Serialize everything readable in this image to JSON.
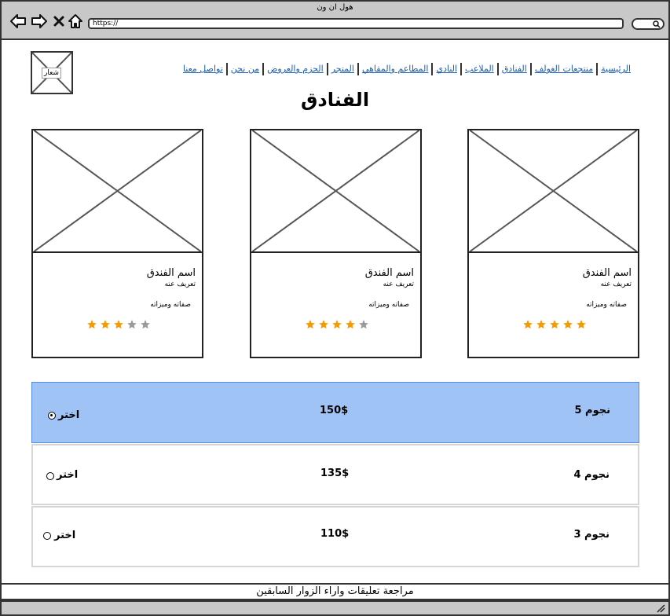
{
  "window": {
    "title": "هول ان ون",
    "url": "https://"
  },
  "logo": {
    "label": "شعار"
  },
  "nav": {
    "items": [
      {
        "label": "الرئيسية"
      },
      {
        "label": "منتجعات الغولف"
      },
      {
        "label": "الفنادق"
      },
      {
        "label": "الملاعب"
      },
      {
        "label": "النادي"
      },
      {
        "label": "المطاعم والمقاهي"
      },
      {
        "label": "المتجر"
      },
      {
        "label": "الحزم والعروض"
      },
      {
        "label": "من نحن"
      },
      {
        "label": "تواصل معنا"
      }
    ]
  },
  "page": {
    "title": "الفنادق"
  },
  "hotels": [
    {
      "name": "اسم الفندق",
      "description": "تعريف عنه",
      "features": "صفاته وميزاته",
      "rating": 5
    },
    {
      "name": "اسم الفندق",
      "description": "تعريف عنه",
      "features": "صفاته وميزاته",
      "rating": 4
    },
    {
      "name": "اسم الفندق",
      "description": "تعريف عنه",
      "features": "صفاته وميزاته",
      "rating": 3
    }
  ],
  "options": [
    {
      "stars": "نجوم 5",
      "price": "150$",
      "choose": "اختر",
      "selected": true
    },
    {
      "stars": "نجوم 4",
      "price": "135$",
      "choose": "اختر",
      "selected": false
    },
    {
      "stars": "نجوم 3",
      "price": "110$",
      "choose": "اختر",
      "selected": false
    }
  ],
  "footer": {
    "text": "مراجعة تعليقات واراء الزوار السابقين"
  },
  "colors": {
    "star_on": "#f59a00",
    "star_off": "#9a9a9a",
    "selected_row": "#a0c3f5",
    "link": "#1a5fb4"
  },
  "icons": {
    "back": "arrow-left-icon",
    "forward": "arrow-right-icon",
    "close": "close-icon",
    "home": "home-icon",
    "search": "search-icon"
  }
}
